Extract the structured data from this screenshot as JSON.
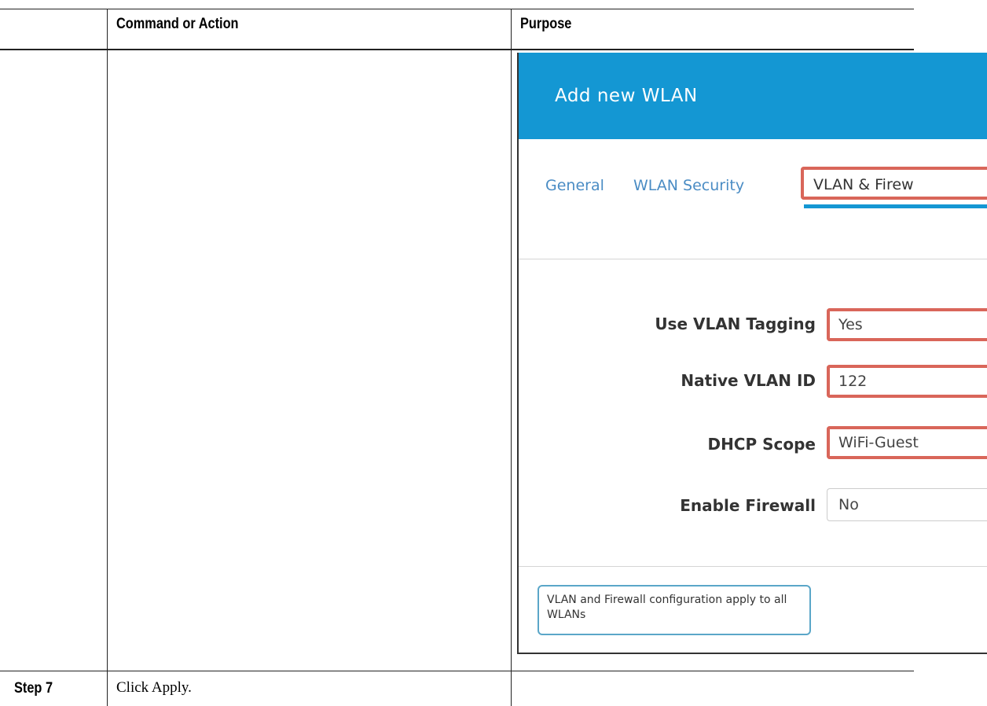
{
  "table": {
    "header_command": "Command or Action",
    "header_purpose": "Purpose",
    "step_label": "Step 7",
    "step_text": "Click Apply."
  },
  "screenshot": {
    "title": "Add new WLAN",
    "tabs": [
      {
        "label": "General"
      },
      {
        "label": "WLAN Security"
      },
      {
        "label": "VLAN & Firew"
      }
    ],
    "fields": [
      {
        "label": "Use VLAN Tagging",
        "value": "Yes",
        "highlighted": true
      },
      {
        "label": "Native VLAN ID",
        "value": "122",
        "highlighted": true
      },
      {
        "label": "DHCP Scope",
        "value": "WiFi-Guest",
        "highlighted": true
      },
      {
        "label": "Enable Firewall",
        "value": "No",
        "highlighted": false
      }
    ],
    "note": "VLAN and Firewall configuration apply to all WLANs",
    "colors": {
      "header_bg": "#1497d3",
      "highlight": "#d9665a",
      "tab_text": "#4a8cc4"
    }
  }
}
